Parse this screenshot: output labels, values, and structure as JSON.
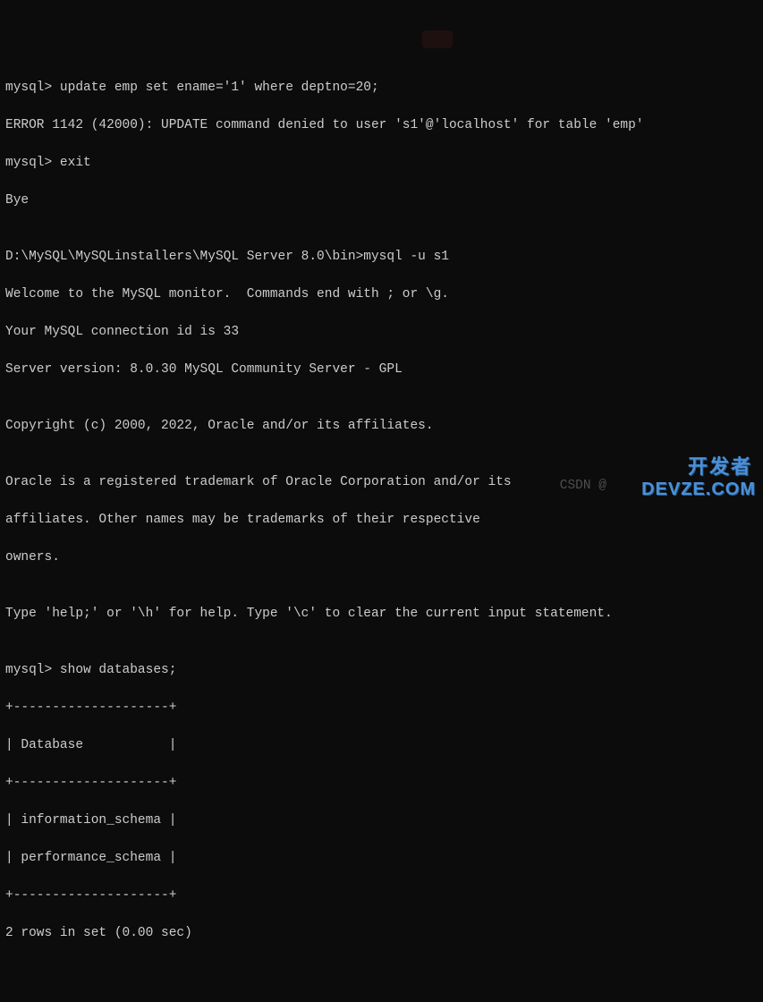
{
  "lines": {
    "l0": "mysql> update emp set ename='1' where deptno=20;",
    "l1": "ERROR 1142 (42000): UPDATE command denied to user 's1'@'localhost' for table 'emp'",
    "l2": "mysql> exit",
    "l3": "Bye",
    "l4": "",
    "l5": "D:\\MySQL\\MySQLinstallers\\MySQL Server 8.0\\bin>mysql -u s1",
    "l6": "Welcome to the MySQL monitor.  Commands end with ; or \\g.",
    "l7": "Your MySQL connection id is 33",
    "l8": "Server version: 8.0.30 MySQL Community Server - GPL",
    "l9": "",
    "l10": "Copyright (c) 2000, 2022, Oracle and/or its affiliates.",
    "l11": "",
    "l12": "Oracle is a registered trademark of Oracle Corporation and/or its",
    "l13": "affiliates. Other names may be trademarks of their respective",
    "l14": "owners.",
    "l15": "",
    "l16": "Type 'help;' or '\\h' for help. Type '\\c' to clear the current input statement.",
    "l17": "",
    "l18": "mysql> show databases;",
    "l19": "+--------------------+",
    "l20": "| Database           |",
    "l21": "+--------------------+",
    "l22": "| information_schema |",
    "l23": "| performance_schema |",
    "l24": "+--------------------+",
    "l25": "2 rows in set (0.00 sec)"
  },
  "watermarks": {
    "csdn": "CSDN @",
    "devze": "DEVZE.COM",
    "cn": "开发者"
  }
}
